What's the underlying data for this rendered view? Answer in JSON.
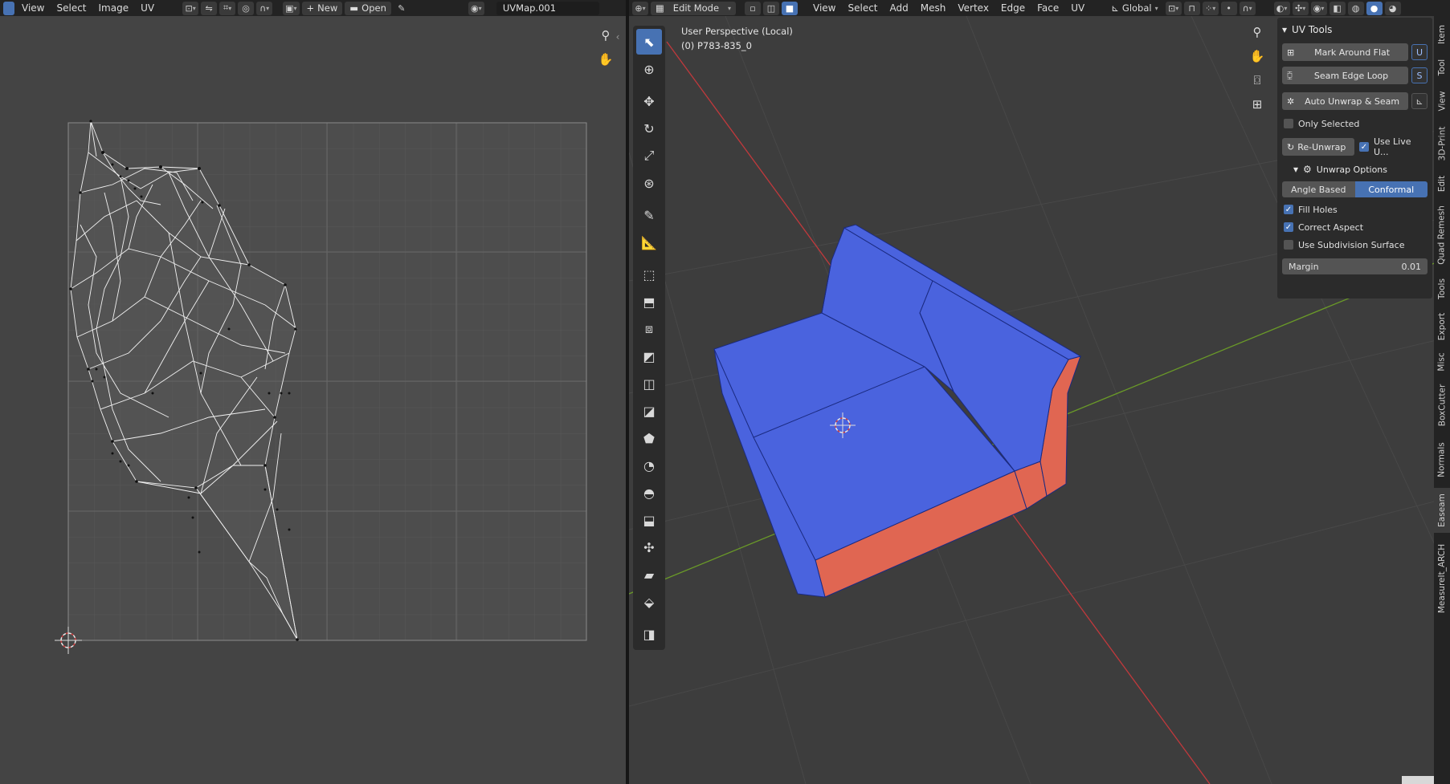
{
  "uv_editor": {
    "menus": [
      "View",
      "Select",
      "Image",
      "UV"
    ],
    "new_label": "New",
    "open_label": "Open",
    "uv_map_name": "UVMap.001"
  },
  "viewport": {
    "mode": "Edit Mode",
    "menus": [
      "View",
      "Select",
      "Add",
      "Mesh",
      "Vertex",
      "Edge",
      "Face",
      "UV"
    ],
    "transform_orientation": "Global",
    "perspective": "User Perspective (Local)",
    "object_name": "(0) P783-835_0",
    "colors": {
      "face_blue": "#4a63de",
      "face_red": "#e06652",
      "x_axis": "#c0393c",
      "y_axis": "#6a9a28"
    }
  },
  "uv_tools": {
    "title": "UV Tools",
    "mark_around_flat": "Mark Around Flat",
    "mark_around_flat_key": "U",
    "seam_edge_loop": "Seam Edge Loop",
    "seam_edge_loop_key": "S",
    "auto_unwrap": "Auto Unwrap & Seam",
    "only_selected": "Only Selected",
    "re_unwrap": "Re-Unwrap",
    "use_live": "Use Live U...",
    "unwrap_options": "Unwrap Options",
    "angle_based": "Angle Based",
    "conformal": "Conformal",
    "fill_holes": "Fill Holes",
    "correct_aspect": "Correct Aspect",
    "use_subdivision": "Use Subdivision Surface",
    "margin_label": "Margin",
    "margin_value": "0.01"
  },
  "side_tabs": [
    "Item",
    "Tool",
    "View",
    "3D-Print",
    "Edit",
    "Quad Remesh",
    "Tools",
    "Export",
    "Misc",
    "BoxCutter",
    "Normals",
    "Easeam",
    "MeasureIt_ARCH"
  ]
}
